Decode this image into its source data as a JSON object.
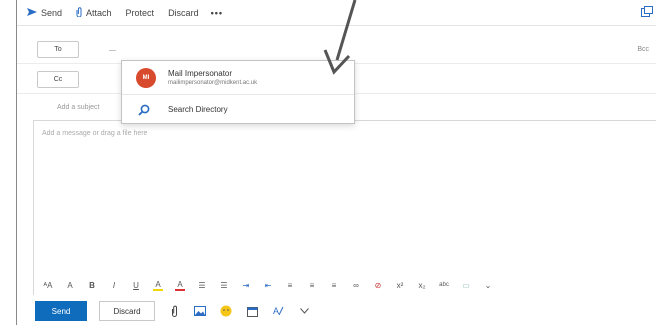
{
  "toolbar": {
    "send_label": "Send",
    "attach_label": "Attach",
    "protect_label": "Protect",
    "discard_label": "Discard",
    "more_label": "•••"
  },
  "header": {
    "to_label": "To",
    "to_value": "—",
    "bcc_label": "Bcc",
    "cc_label": "Cc",
    "subject_placeholder": "Add a subject"
  },
  "suggestions": {
    "contact_initials": "MI",
    "contact_name": "Mail Impersonator",
    "contact_email": "mailimpersonator@midkent.ac.uk",
    "search_directory_label": "Search Directory"
  },
  "body": {
    "placeholder": "Add a message or drag a file here"
  },
  "format_bar": {
    "items": [
      "ᴬA",
      "A",
      "B",
      "I",
      "U",
      "A",
      "A",
      "☰",
      "☰",
      "⇥",
      "⇤",
      "≡",
      "≡",
      "≡",
      "∞",
      "⊘",
      "x²",
      "x₂",
      "abc",
      "▭",
      "⌄"
    ]
  },
  "actions": {
    "send_label": "Send",
    "discard_label": "Discard"
  },
  "colors": {
    "accent": "#0f6cbd",
    "avatar": "#d84a2e"
  }
}
